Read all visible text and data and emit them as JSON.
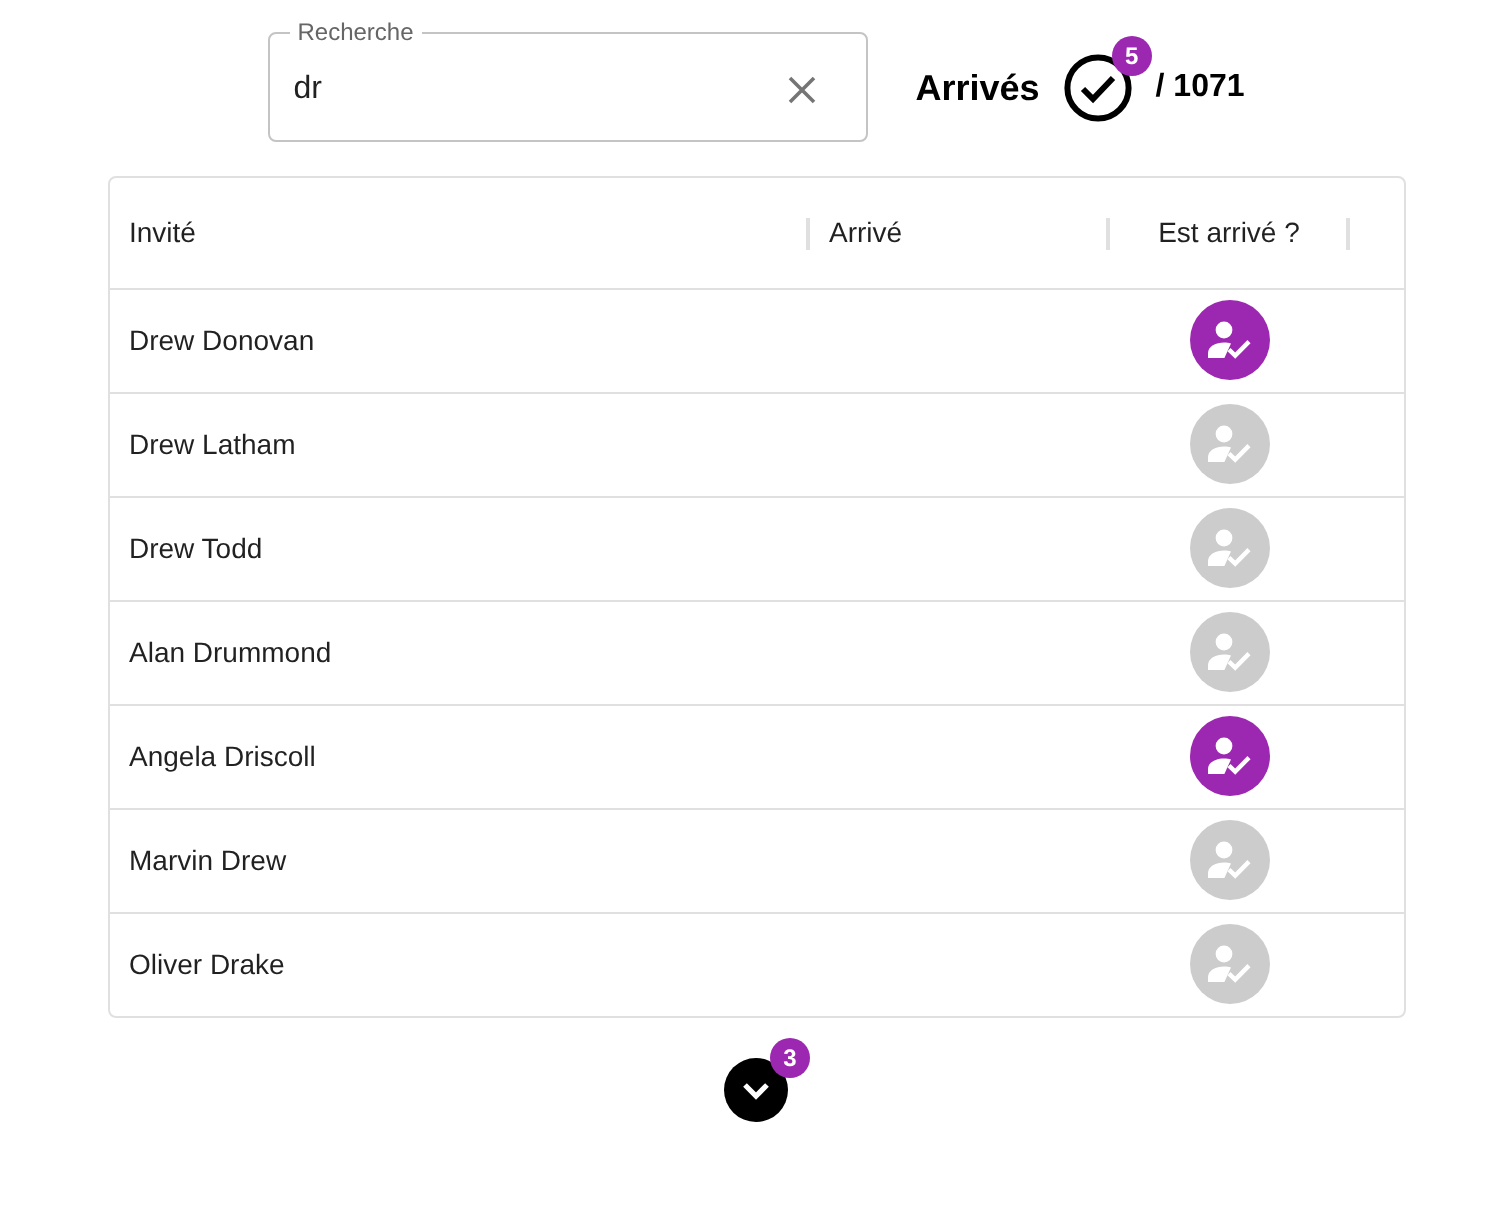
{
  "search": {
    "label": "Recherche",
    "value": "dr"
  },
  "arrivals": {
    "label": "Arrivés",
    "count_badge": "5",
    "total": "/ 1071"
  },
  "table": {
    "columns": [
      "Invité",
      "Arrivé",
      "Est arrivé ?"
    ],
    "rows": [
      {
        "guest": "Drew Donovan",
        "checked": true
      },
      {
        "guest": "Drew Latham",
        "checked": false
      },
      {
        "guest": "Drew Todd",
        "checked": false
      },
      {
        "guest": "Alan Drummond",
        "checked": false
      },
      {
        "guest": "Angela Driscoll",
        "checked": true
      },
      {
        "guest": "Marvin Drew",
        "checked": false
      },
      {
        "guest": "Oliver Drake",
        "checked": false
      }
    ]
  },
  "load_more": {
    "badge": "3"
  }
}
